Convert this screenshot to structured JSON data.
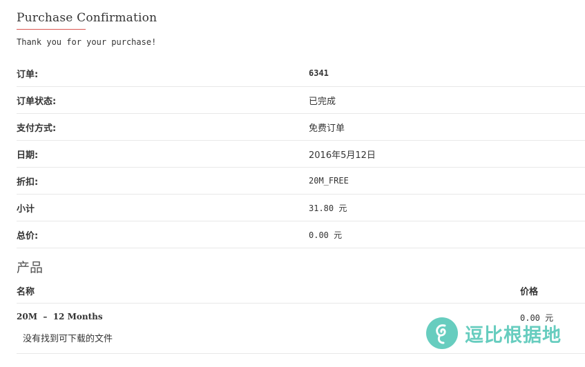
{
  "header": {
    "title": "Purchase Confirmation",
    "subtitle": "Thank you for your purchase!"
  },
  "summary": [
    {
      "label": "订单:",
      "value": "6341"
    },
    {
      "label": "订单状态:",
      "value": "已完成"
    },
    {
      "label": "支付方式:",
      "value": "免费订单"
    },
    {
      "label": "日期:",
      "value": "2016年5月12日"
    },
    {
      "label": "折扣:",
      "value": "20M_FREE"
    },
    {
      "label": "小计",
      "value": "31.80 元"
    },
    {
      "label": "总价:",
      "value": "0.00 元"
    }
  ],
  "products": {
    "heading": "产品",
    "columns": {
      "name": "名称",
      "price": "价格"
    },
    "items": [
      {
        "name": "20M  –  12 Months",
        "no_files": "没有找到可下载的文件",
        "price": "0.00 元"
      }
    ]
  },
  "watermark": {
    "text": "逗比根据地",
    "icon": "swirl-logo-icon",
    "color": "#3dbfae"
  }
}
